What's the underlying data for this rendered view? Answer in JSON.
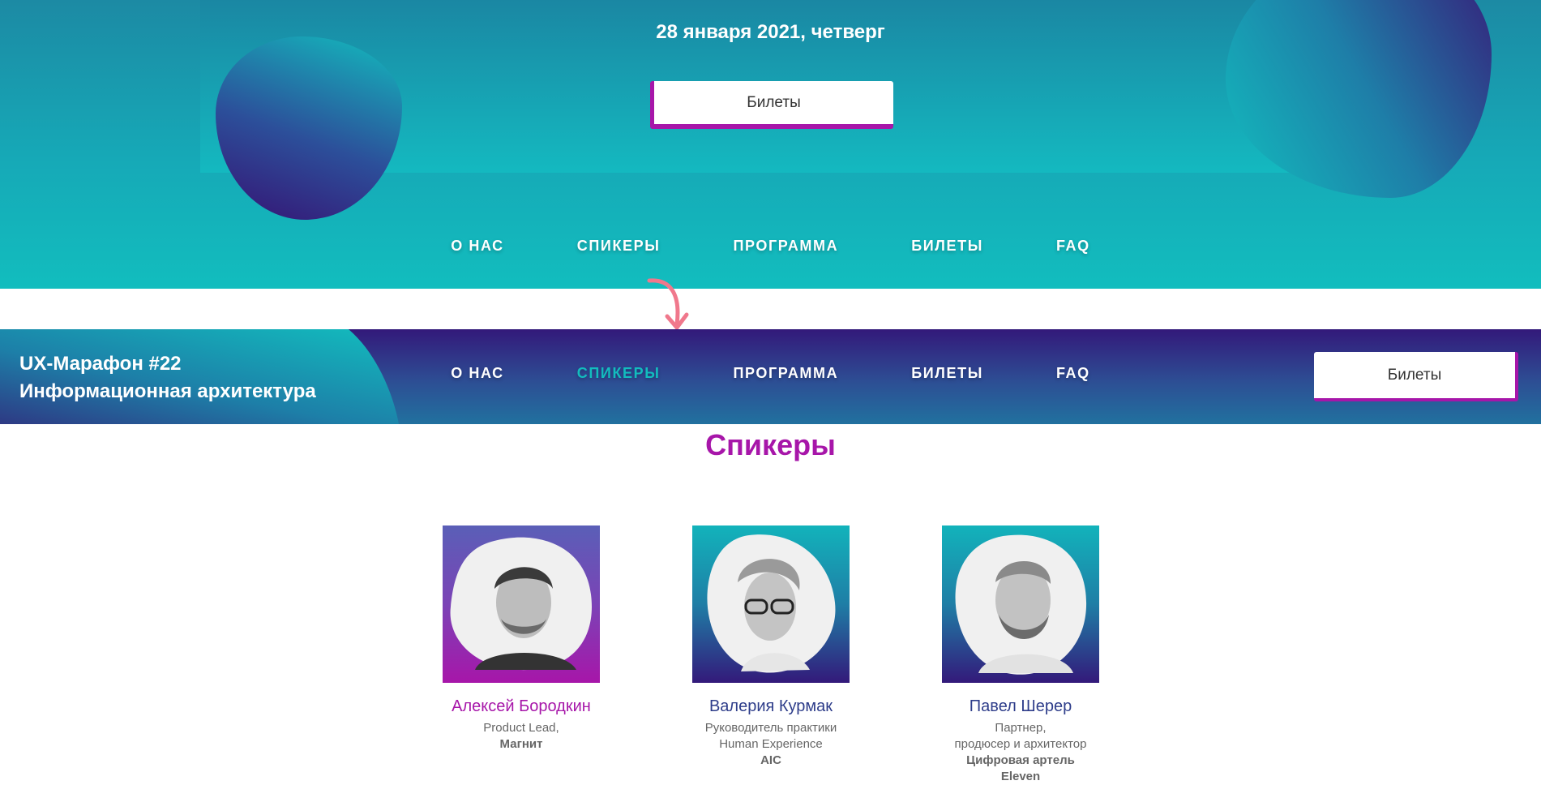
{
  "hero": {
    "date": "28 января 2021, четверг",
    "tickets_button": "Билеты"
  },
  "nav": {
    "items": [
      {
        "label": "О НАС"
      },
      {
        "label": "СПИКЕРЫ"
      },
      {
        "label": "ПРОГРАММА"
      },
      {
        "label": "БИЛЕТЫ"
      },
      {
        "label": "FAQ"
      }
    ],
    "active_sticky": "СПИКЕРЫ"
  },
  "sticky_header": {
    "title_line1": "UX-Марафон #22",
    "title_line2": "Информационная архитектура",
    "tickets_button": "Билеты"
  },
  "speakers_section": {
    "title": "Спикеры",
    "speakers": [
      {
        "name": "Алексей Бородкин",
        "role_line1": "Product Lead,",
        "role_line2": "",
        "company_line1": "Магнит",
        "company_line2": ""
      },
      {
        "name": "Валерия Курмак",
        "role_line1": "Руководитель практики",
        "role_line2": "Human Experience",
        "company_line1": "AIC",
        "company_line2": ""
      },
      {
        "name": "Павел Шерер",
        "role_line1": "Партнер,",
        "role_line2": "продюсер и архитектор",
        "company_line1": "Цифровая артель",
        "company_line2": "Eleven"
      }
    ]
  },
  "colors": {
    "accent": "#a716a9",
    "teal": "#12bdbe",
    "navy": "#33197a"
  }
}
